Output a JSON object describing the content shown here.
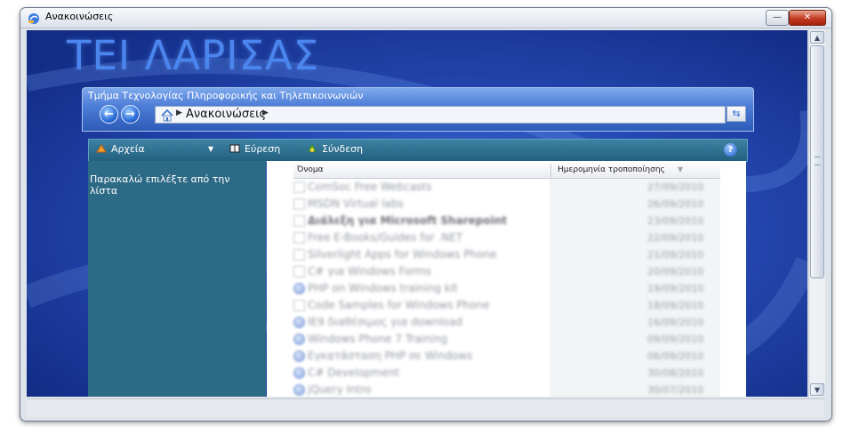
{
  "window": {
    "title": "Ανακοινώσεις",
    "minimize_label": "—",
    "close_label": "✕"
  },
  "site": {
    "title": "ΤΕΙ ΛΑΡΙΣΑΣ",
    "department": "Τμήμα Τεχνολογίας Πληροφορικής και Τηλεπικοινωνιών"
  },
  "nav": {
    "back_label": "←",
    "forward_label": "→",
    "address": "Ανακοινώσεις"
  },
  "toolbar": {
    "files_label": "Αρχεία",
    "search_label": "Εύρεση",
    "connect_label": "Σύνδεση",
    "help_label": "?"
  },
  "left_panel": {
    "message": "Παρακαλώ επιλέξτε από την λίστα"
  },
  "list": {
    "columns": [
      "Όνομα",
      "Ημερομηνία τροποποίησης"
    ],
    "rows": [
      {
        "title": "ComSoc Free Webcasts",
        "date": "27/09/2010",
        "icon": "page-icon"
      },
      {
        "title": "MSDN Virtual labs",
        "date": "26/09/2010",
        "icon": "page-icon"
      },
      {
        "title": "Διάλεξη για Microsoft Sharepoint",
        "date": "23/09/2010",
        "icon": "page-icon",
        "bold": true
      },
      {
        "title": "Free E-Books/Guides for .NET",
        "date": "22/09/2010",
        "icon": "page-icon"
      },
      {
        "title": "Silverlight Apps for Windows Phone",
        "date": "21/09/2010",
        "icon": "page-icon"
      },
      {
        "title": "C# για Windows Forms",
        "date": "20/09/2010",
        "icon": "page-icon"
      },
      {
        "title": "PHP on Windows training kit",
        "date": "19/09/2010",
        "icon": "globe-icon"
      },
      {
        "title": "Code Samples for Windows Phone",
        "date": "18/09/2010",
        "icon": "page-icon"
      },
      {
        "title": "IE9 διαθέσιμος για download",
        "date": "16/09/2010",
        "icon": "globe-icon"
      },
      {
        "title": "Windows Phone 7 Training",
        "date": "09/09/2010",
        "icon": "globe-icon"
      },
      {
        "title": "Εγκατάσταση PHP σε Windows",
        "date": "06/09/2010",
        "icon": "globe-icon"
      },
      {
        "title": "C# Development",
        "date": "30/08/2010",
        "icon": "globe-icon"
      },
      {
        "title": "jQuery Intro",
        "date": "30/07/2010",
        "icon": "globe-icon"
      }
    ]
  },
  "colors": {
    "background_blue": "#1d3fa6",
    "title_blue": "#4b85ee",
    "toolbar_teal": "#2d6a86",
    "close_red": "#c43a22"
  }
}
